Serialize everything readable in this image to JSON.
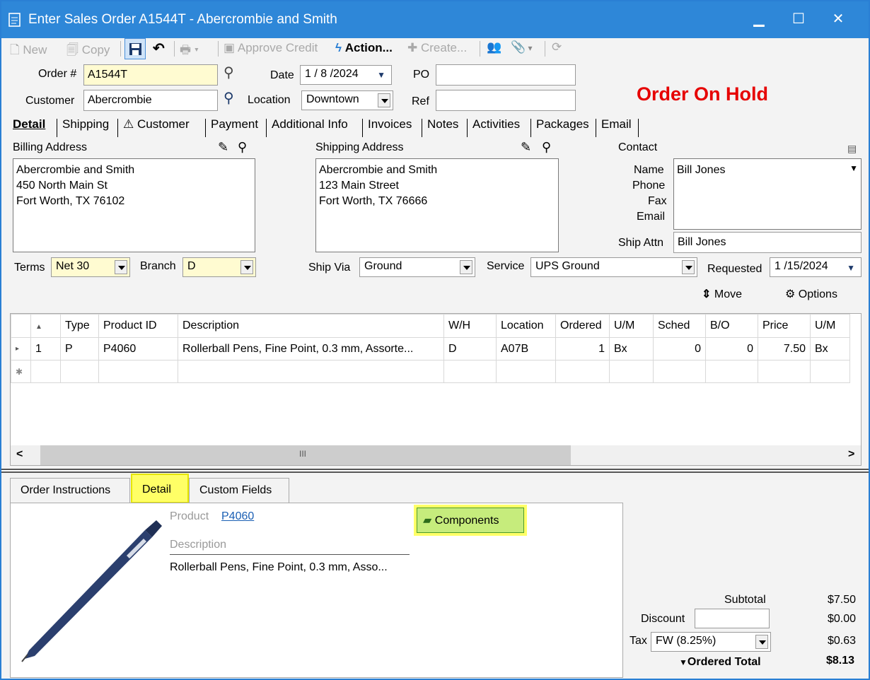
{
  "window": {
    "title": "Enter Sales Order A1544T - Abercrombie and Smith"
  },
  "toolbar": {
    "new": "New",
    "copy": "Copy",
    "approve_credit": "Approve Credit",
    "action": "Action...",
    "create": "Create..."
  },
  "header": {
    "order_label": "Order #",
    "order_value": "A1544T",
    "customer_label": "Customer",
    "customer_value": "Abercrombie",
    "date_label": "Date",
    "date_value": "1 / 8 /2024",
    "location_label": "Location",
    "location_value": "Downtown",
    "po_label": "PO",
    "po_value": "",
    "ref_label": "Ref",
    "ref_value": "",
    "hold_status": "Order On Hold",
    "hold_color": "#e60000"
  },
  "tabs": [
    "Detail",
    "Shipping",
    "Customer",
    "Payment",
    "Additional Info",
    "Invoices",
    "Notes",
    "Activities",
    "Packages",
    "Email"
  ],
  "billing": {
    "label": "Billing Address",
    "lines": [
      "Abercrombie and Smith",
      "450 North Main St",
      "Fort Worth, TX 76102"
    ]
  },
  "shipping": {
    "label": "Shipping Address",
    "lines": [
      "Abercrombie and Smith",
      "123 Main Street",
      "Fort Worth, TX 76666"
    ]
  },
  "contact": {
    "label": "Contact",
    "name_label": "Name",
    "name_value": "Bill Jones",
    "phone_label": "Phone",
    "fax_label": "Fax",
    "email_label": "Email",
    "ship_attn_label": "Ship Attn",
    "ship_attn_value": "Bill Jones"
  },
  "terms": {
    "terms_label": "Terms",
    "terms_value": "Net 30",
    "branch_label": "Branch",
    "branch_value": "D",
    "ship_via_label": "Ship Via",
    "ship_via_value": "Ground",
    "service_label": "Service",
    "service_value": "UPS Ground",
    "requested_label": "Requested",
    "requested_value": "1 /15/2024"
  },
  "actions": {
    "move": "Move",
    "options": "Options"
  },
  "grid": {
    "columns": [
      "",
      "Type",
      "Product ID",
      "Description",
      "W/H",
      "Location",
      "Ordered",
      "U/M",
      "Sched",
      "B/O",
      "Price",
      "U/M"
    ],
    "rows": [
      [
        "1",
        "P",
        "P4060",
        "Rollerball Pens, Fine Point, 0.3 mm, Assorte...",
        "D",
        "A07B",
        "1",
        "Bx",
        "0",
        "0",
        "7.50",
        "Bx"
      ]
    ],
    "scroll_mid": "III"
  },
  "bottom_tabs": [
    "Order Instructions",
    "Detail",
    "Custom Fields"
  ],
  "detail_panel": {
    "product_label": "Product",
    "product_value": "P4060",
    "description_label": "Description",
    "description_value": "Rollerball Pens, Fine Point, 0.3 mm, Asso...",
    "components_button": "Components"
  },
  "totals": {
    "subtotal_label": "Subtotal",
    "subtotal_value": "$7.50",
    "discount_label": "Discount",
    "discount_value": "$0.00",
    "tax_label": "Tax",
    "tax_code": "FW (8.25%)",
    "tax_value": "$0.63",
    "ordered_total_label": "Ordered Total",
    "ordered_total_value": "$8.13"
  }
}
